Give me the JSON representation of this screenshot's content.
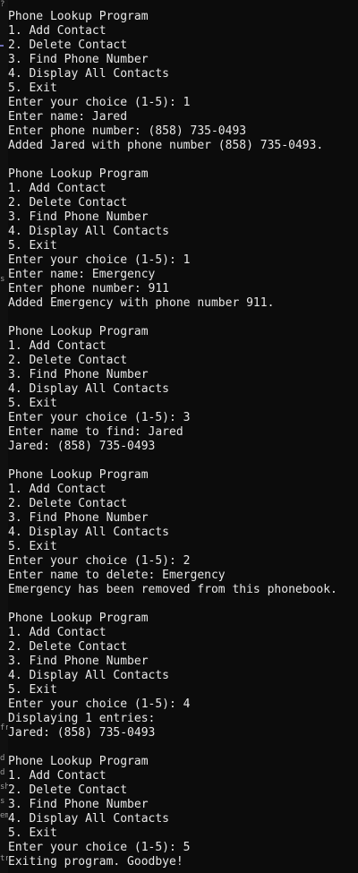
{
  "terminal": {
    "gutter_marks": [
      "?",
      "s",
      "fr",
      "d",
      "d",
      "sh",
      "s",
      "em",
      "tr"
    ],
    "lines": [
      "Phone Lookup Program",
      "1. Add Contact",
      "2. Delete Contact",
      "3. Find Phone Number",
      "4. Display All Contacts",
      "5. Exit",
      "Enter your choice (1-5): 1",
      "Enter name: Jared",
      "Enter phone number: (858) 735-0493",
      "Added Jared with phone number (858) 735-0493.",
      "",
      "Phone Lookup Program",
      "1. Add Contact",
      "2. Delete Contact",
      "3. Find Phone Number",
      "4. Display All Contacts",
      "5. Exit",
      "Enter your choice (1-5): 1",
      "Enter name: Emergency",
      "Enter phone number: 911",
      "Added Emergency with phone number 911.",
      "",
      "Phone Lookup Program",
      "1. Add Contact",
      "2. Delete Contact",
      "3. Find Phone Number",
      "4. Display All Contacts",
      "5. Exit",
      "Enter your choice (1-5): 3",
      "Enter name to find: Jared",
      "Jared: (858) 735-0493",
      "",
      "Phone Lookup Program",
      "1. Add Contact",
      "2. Delete Contact",
      "3. Find Phone Number",
      "4. Display All Contacts",
      "5. Exit",
      "Enter your choice (1-5): 2",
      "Enter name to delete: Emergency",
      "Emergency has been removed from this phonebook.",
      "",
      "Phone Lookup Program",
      "1. Add Contact",
      "2. Delete Contact",
      "3. Find Phone Number",
      "4. Display All Contacts",
      "5. Exit",
      "Enter your choice (1-5): 4",
      "Displaying 1 entries:",
      "Jared: (858) 735-0493",
      "",
      "Phone Lookup Program",
      "1. Add Contact",
      "2. Delete Contact",
      "3. Find Phone Number",
      "4. Display All Contacts",
      "5. Exit",
      "Enter your choice (1-5): 5",
      "Exiting program. Goodbye!"
    ]
  }
}
